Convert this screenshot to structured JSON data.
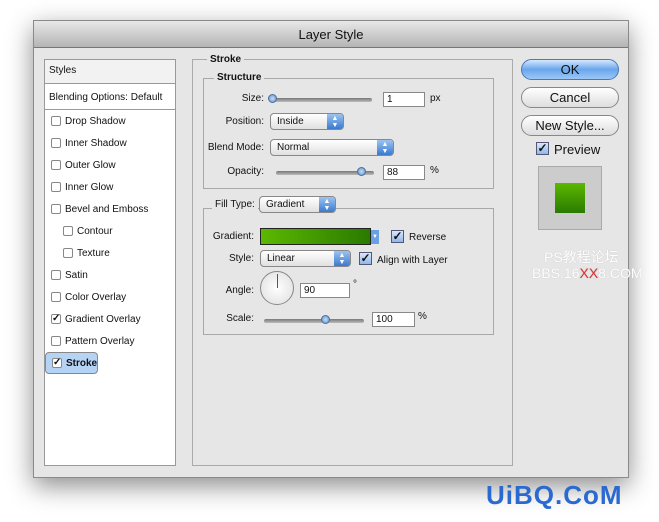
{
  "window": {
    "title": "Layer Style"
  },
  "sidebar": {
    "header": "Styles",
    "blending": "Blending Options: Default",
    "items": [
      {
        "label": "Drop Shadow",
        "checked": false,
        "sub": false
      },
      {
        "label": "Inner Shadow",
        "checked": false,
        "sub": false
      },
      {
        "label": "Outer Glow",
        "checked": false,
        "sub": false
      },
      {
        "label": "Inner Glow",
        "checked": false,
        "sub": false
      },
      {
        "label": "Bevel and Emboss",
        "checked": false,
        "sub": false
      },
      {
        "label": "Contour",
        "checked": false,
        "sub": true
      },
      {
        "label": "Texture",
        "checked": false,
        "sub": true
      },
      {
        "label": "Satin",
        "checked": false,
        "sub": false
      },
      {
        "label": "Color Overlay",
        "checked": false,
        "sub": false
      },
      {
        "label": "Gradient Overlay",
        "checked": true,
        "sub": false
      },
      {
        "label": "Pattern Overlay",
        "checked": false,
        "sub": false
      },
      {
        "label": "Stroke",
        "checked": true,
        "sub": false,
        "selected": true
      }
    ]
  },
  "stroke": {
    "title": "Stroke",
    "structure": {
      "title": "Structure",
      "size_label": "Size:",
      "size": "1",
      "size_unit": "px",
      "position_label": "Position:",
      "position": "Inside",
      "blend_label": "Blend Mode:",
      "blend": "Normal",
      "opacity_label": "Opacity:",
      "opacity": "88",
      "opacity_unit": "%"
    },
    "fill_label": "Fill Type:",
    "fill": "Gradient",
    "gradient_label": "Gradient:",
    "reverse": "Reverse",
    "style_label": "Style:",
    "style": "Linear",
    "align": "Align with Layer",
    "angle_label": "Angle:",
    "angle": "90",
    "angle_unit": "°",
    "scale_label": "Scale:",
    "scale": "100",
    "scale_unit": "%",
    "gradient_colors": [
      "#5cb800",
      "#2a7a00"
    ]
  },
  "buttons": {
    "ok": "OK",
    "cancel": "Cancel",
    "new_style": "New Style...",
    "preview": "Preview"
  },
  "preview_color": "#3f9a00",
  "watermark": {
    "line1": "PS教程论坛",
    "line2a": "BBS.16",
    "line2b": "XX",
    "line2c": "8.COM",
    "bottom": "UiBQ.CoM"
  }
}
